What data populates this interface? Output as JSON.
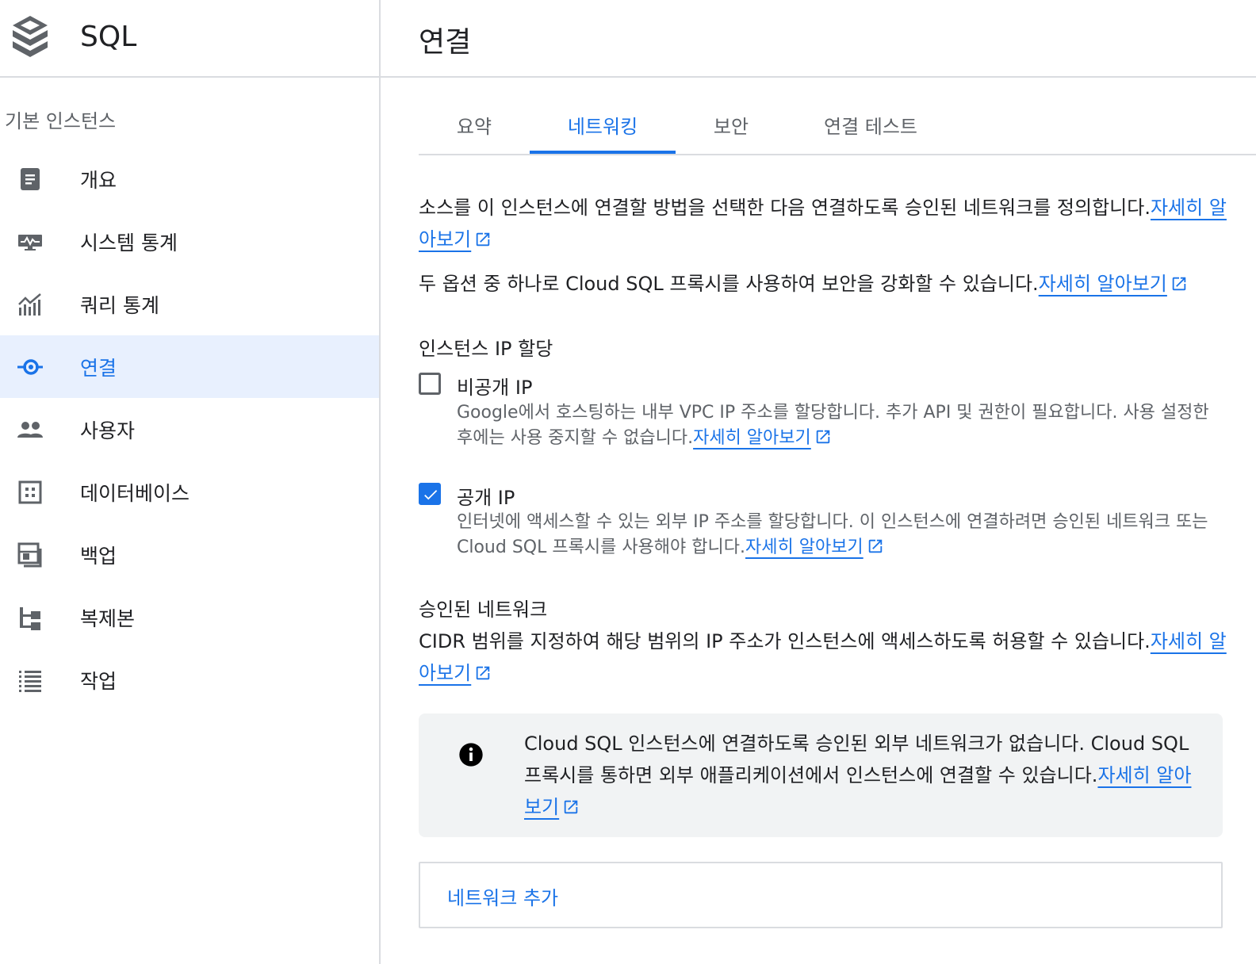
{
  "sidebar": {
    "brand_title": "SQL",
    "brand_icon": "cloud-sql-icon",
    "section_title": "기본 인스턴스",
    "items": [
      {
        "label": "개요",
        "icon": "clipboard-icon",
        "active": false
      },
      {
        "label": "시스템 통계",
        "icon": "monitor-icon",
        "active": false
      },
      {
        "label": "쿼리 통계",
        "icon": "chart-icon",
        "active": false
      },
      {
        "label": "연결",
        "icon": "connection-icon",
        "active": true
      },
      {
        "label": "사용자",
        "icon": "people-icon",
        "active": false
      },
      {
        "label": "데이터베이스",
        "icon": "database-grid-icon",
        "active": false
      },
      {
        "label": "백업",
        "icon": "backup-icon",
        "active": false
      },
      {
        "label": "복제본",
        "icon": "replica-icon",
        "active": false
      },
      {
        "label": "작업",
        "icon": "list-icon",
        "active": false
      }
    ]
  },
  "header": {
    "title": "연결"
  },
  "tabs": [
    {
      "label": "요약",
      "active": false
    },
    {
      "label": "네트워킹",
      "active": true
    },
    {
      "label": "보안",
      "active": false
    },
    {
      "label": "연결 테스트",
      "active": false
    }
  ],
  "intro": {
    "text1": "소스를 이 인스턴스에 연결할 방법을 선택한 다음 연결하도록 승인된 네트워크를 정의합니다.",
    "link1": "자세히 알아보기",
    "text2": "두 옵션 중 하나로 Cloud SQL 프록시를 사용하여 보안을 강화할 수 있습니다.",
    "link2": "자세히 알아보기"
  },
  "ip_assignment": {
    "title": "인스턴스 IP 할당",
    "private": {
      "label": "비공개 IP",
      "checked": false,
      "description": "Google에서 호스팅하는 내부 VPC IP 주소를 할당합니다. 추가 API 및 권한이 필요합니다. 사용 설정한 후에는 사용 중지할 수 없습니다.",
      "link": "자세히 알아보기"
    },
    "public": {
      "label": "공개 IP",
      "checked": true,
      "description": "인터넷에 액세스할 수 있는 외부 IP 주소를 할당합니다. 이 인스턴스에 연결하려면 승인된 네트워크 또는 Cloud SQL 프록시를 사용해야 합니다.",
      "link": "자세히 알아보기"
    }
  },
  "authorized_networks": {
    "title": "승인된 네트워크",
    "description": "CIDR 범위를 지정하여 해당 범위의 IP 주소가 인스턴스에 액세스하도록 허용할 수 있습니다.",
    "link": "자세히 알아보기",
    "info_text": "Cloud SQL 인스턴스에 연결하도록 승인된 외부 네트워크가 없습니다. Cloud SQL 프록시를 통하면 외부 애플리케이션에서 인스턴스에 연결할 수 있습니다.",
    "info_link": "자세히 알아보기",
    "info_icon": "info-icon",
    "add_button": "네트워크 추가"
  },
  "colors": {
    "accent": "#1a73e8",
    "active_bg": "#e8f0fe",
    "icon_gray": "#5f6368",
    "info_bg": "#f1f3f4"
  }
}
